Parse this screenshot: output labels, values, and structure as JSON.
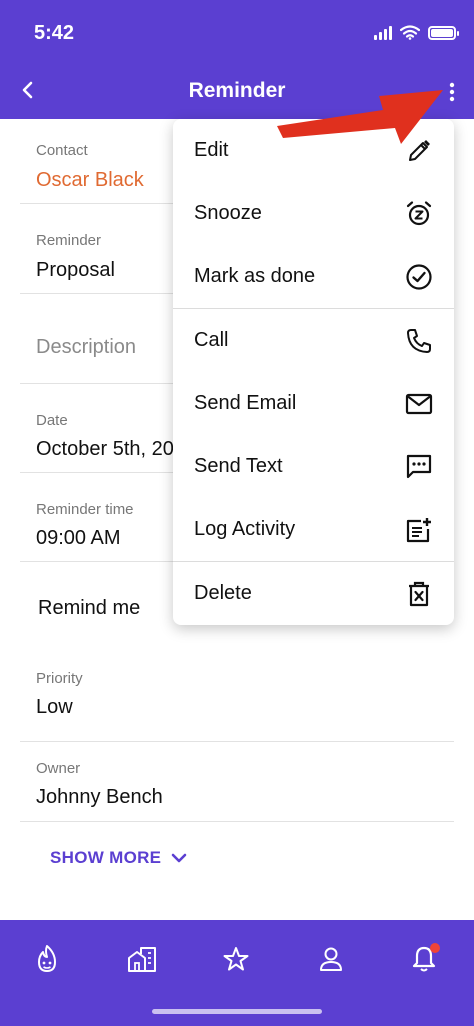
{
  "status_bar": {
    "time": "5:42"
  },
  "header": {
    "title": "Reminder"
  },
  "fields": {
    "contact": {
      "label": "Contact",
      "value": "Oscar Black"
    },
    "reminder": {
      "label": "Reminder",
      "value": "Proposal"
    },
    "description": {
      "placeholder": "Description"
    },
    "date": {
      "label": "Date",
      "value": "October 5th, 20"
    },
    "reminder_time": {
      "label": "Reminder time",
      "value": "09:00 AM"
    },
    "remind_me": {
      "label": "Remind me"
    },
    "priority": {
      "label": "Priority",
      "value": "Low"
    },
    "owner": {
      "label": "Owner",
      "value": "Johnny Bench"
    }
  },
  "show_more": {
    "label": "SHOW MORE",
    "icon": "chevron-down-icon"
  },
  "menu": {
    "items": [
      {
        "label": "Edit",
        "icon": "pencil-icon"
      },
      {
        "label": "Snooze",
        "icon": "alarm-snooze-icon"
      },
      {
        "label": "Mark as done",
        "icon": "check-circle-icon"
      },
      {
        "label": "Call",
        "icon": "phone-icon"
      },
      {
        "label": "Send Email",
        "icon": "envelope-icon"
      },
      {
        "label": "Send Text",
        "icon": "message-icon"
      },
      {
        "label": "Log Activity",
        "icon": "note-add-icon"
      },
      {
        "label": "Delete",
        "icon": "trash-icon"
      }
    ]
  },
  "tabs": [
    {
      "name": "leads",
      "icon": "flame-face-icon"
    },
    {
      "name": "companies",
      "icon": "building-icon"
    },
    {
      "name": "favorites",
      "icon": "star-icon"
    },
    {
      "name": "contacts",
      "icon": "person-icon"
    },
    {
      "name": "notifications",
      "icon": "bell-icon",
      "badge": true
    }
  ],
  "colors": {
    "brand": "#5b3fd1",
    "contact_accent": "#e06a32",
    "annotation_arrow": "#e0301e",
    "notification_dot": "#f04438"
  }
}
